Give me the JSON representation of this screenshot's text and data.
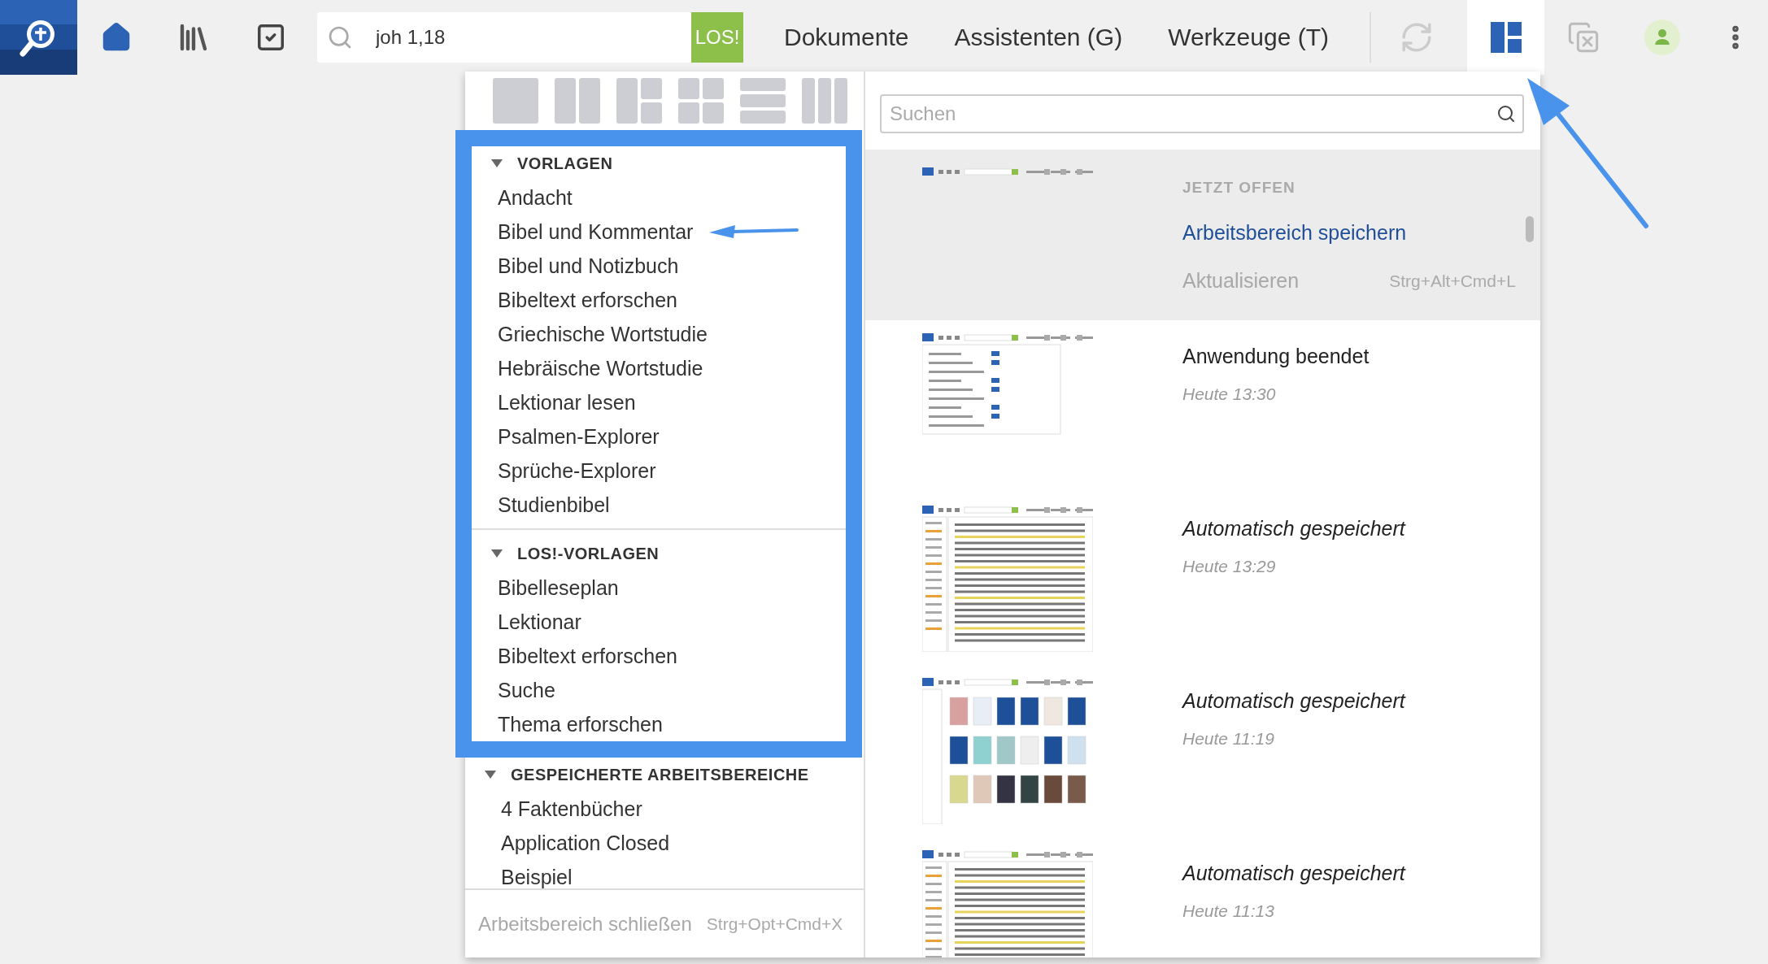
{
  "toolbar": {
    "search": {
      "value": "joh 1,18"
    },
    "go_button": "LOS!",
    "menus": [
      "Dokumente",
      "Assistenten (G)",
      "Werkzeuge (T)"
    ],
    "layout_button": {
      "selected": true
    }
  },
  "layout_panel": {
    "sections": [
      {
        "title": "VORLAGEN",
        "expanded": true,
        "highlighted": true,
        "items": [
          {
            "label": "Andacht",
            "annotated": false
          },
          {
            "label": "Bibel und Kommentar",
            "annotated": true
          },
          {
            "label": "Bibel und Notizbuch",
            "annotated": false
          },
          {
            "label": "Bibeltext erforschen",
            "annotated": false
          },
          {
            "label": "Griechische Wortstudie",
            "annotated": false
          },
          {
            "label": "Hebräische Wortstudie",
            "annotated": false
          },
          {
            "label": "Lektionar lesen",
            "annotated": false
          },
          {
            "label": "Psalmen-Explorer",
            "annotated": false
          },
          {
            "label": "Sprüche-Explorer",
            "annotated": false
          },
          {
            "label": "Studienbibel",
            "annotated": false
          }
        ]
      },
      {
        "title": "LOS!-VORLAGEN",
        "expanded": true,
        "highlighted": true,
        "items": [
          {
            "label": "Bibelleseplan",
            "annotated": false
          },
          {
            "label": "Lektionar",
            "annotated": false
          },
          {
            "label": "Bibeltext erforschen",
            "annotated": false
          },
          {
            "label": "Suche",
            "annotated": false
          },
          {
            "label": "Thema erforschen",
            "annotated": false
          }
        ]
      },
      {
        "title": "GESPEICHERTE ARBEITSBEREICHE",
        "expanded": true,
        "highlighted": false,
        "items": [
          {
            "label": "4 Faktenbücher",
            "annotated": false
          },
          {
            "label": "Application Closed",
            "annotated": false
          },
          {
            "label": "Beispiel",
            "annotated": false
          }
        ]
      }
    ],
    "footer": {
      "label": "Arbeitsbereich schließen",
      "shortcut": "Strg+Opt+Cmd+X",
      "disabled": true
    }
  },
  "workspaces_panel": {
    "search": {
      "placeholder": "Suchen"
    },
    "current": {
      "heading": "JETZT OFFEN",
      "actions": [
        {
          "label": "Arbeitsbereich speichern",
          "disabled": false
        },
        {
          "label": "Aktualisieren",
          "shortcut": "Strg+Alt+Cmd+L",
          "disabled": true
        }
      ]
    },
    "workspaces": [
      {
        "title": "Anwendung beendet",
        "time": "Heute 13:30",
        "autosaved": false,
        "kind": "settings"
      },
      {
        "title": "Automatisch gespeichert",
        "time": "Heute 13:29",
        "autosaved": true,
        "kind": "document"
      },
      {
        "title": "Automatisch gespeichert",
        "time": "Heute 11:19",
        "autosaved": true,
        "kind": "library"
      },
      {
        "title": "Automatisch gespeichert",
        "time": "Heute 11:13",
        "autosaved": true,
        "kind": "document"
      }
    ]
  }
}
